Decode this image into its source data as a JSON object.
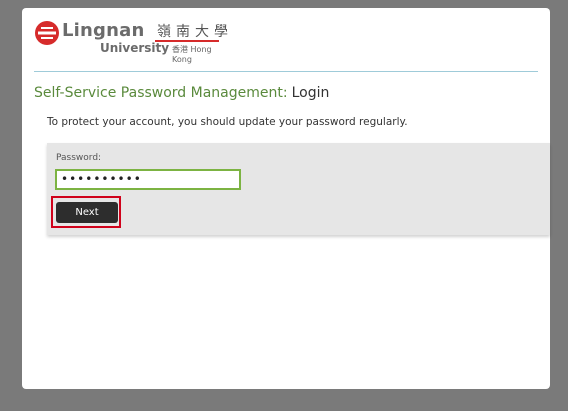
{
  "logo": {
    "name": "Lingnan",
    "university": "University",
    "chinese": "嶺南大學",
    "location": "香港 Hong Kong",
    "icon": "lingnan-logo-icon"
  },
  "page": {
    "title": "Self-Service Password Management:",
    "subtitle": "Login",
    "intro": "To protect your account, you should update your password regularly."
  },
  "form": {
    "password_label": "Password:",
    "password_value": "••••••••••",
    "next_label": "Next"
  },
  "colors": {
    "title_green": "#5a8a3c",
    "input_border": "#7cb342",
    "highlight_red": "#d0021b",
    "button_bg": "#2d2d2d"
  }
}
